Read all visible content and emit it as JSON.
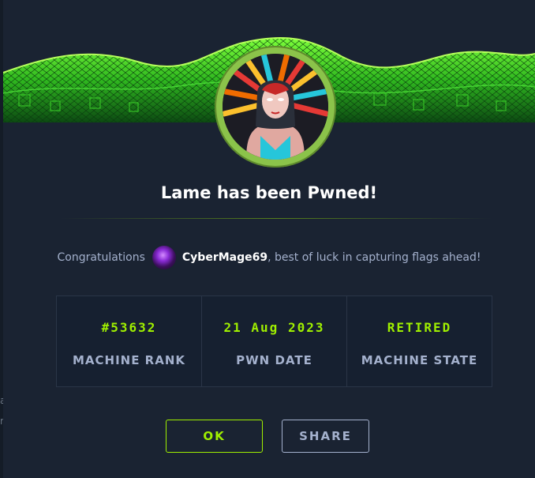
{
  "modal": {
    "title": "Lame has been Pwned!",
    "congrats_prefix": "Congratulations",
    "username": "CyberMage69",
    "congrats_suffix": ", best of luck in capturing flags ahead!",
    "stats": [
      {
        "value": "#53632",
        "label": "MACHINE RANK"
      },
      {
        "value": "21 Aug 2023",
        "label": "PWN DATE"
      },
      {
        "value": "RETIRED",
        "label": "MACHINE STATE"
      }
    ],
    "buttons": {
      "ok_label": "OK",
      "share_label": "SHARE"
    }
  },
  "background": {
    "ghost_a": "a",
    "ghost_b": "r"
  },
  "colors": {
    "accent": "#9fef00",
    "background": "#1a2332",
    "muted_text": "#a4b1cd"
  }
}
